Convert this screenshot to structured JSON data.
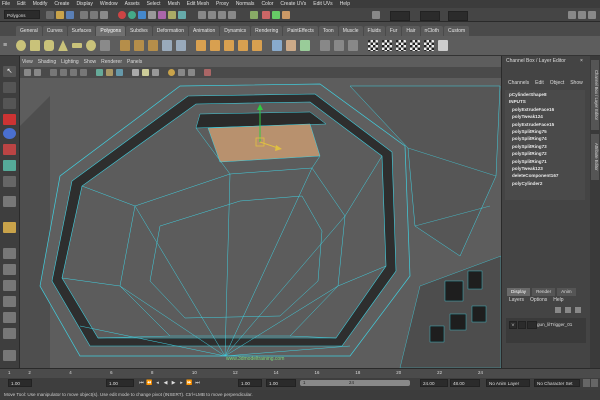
{
  "menubar": [
    "File",
    "Edit",
    "Modify",
    "Create",
    "Display",
    "Window",
    "Assets",
    "Select",
    "Mesh",
    "Edit Mesh",
    "Proxy",
    "Normals",
    "Color",
    "Create UVs",
    "Edit UVs",
    "Help"
  ],
  "status": {
    "mode": "Polygons"
  },
  "shelf_tabs": [
    {
      "label": "General"
    },
    {
      "label": "Curves"
    },
    {
      "label": "Surfaces"
    },
    {
      "label": "Polygons",
      "active": true
    },
    {
      "label": "Subdivs"
    },
    {
      "label": "Deformation"
    },
    {
      "label": "Animation"
    },
    {
      "label": "Dynamics"
    },
    {
      "label": "Rendering"
    },
    {
      "label": "PaintEffects"
    },
    {
      "label": "Toon"
    },
    {
      "label": "Muscle"
    },
    {
      "label": "Fluids"
    },
    {
      "label": "Fur"
    },
    {
      "label": "Hair"
    },
    {
      "label": "nCloth"
    },
    {
      "label": "Custom"
    }
  ],
  "viewport": {
    "menu": [
      "View",
      "Shading",
      "Lighting",
      "Show",
      "Renderer",
      "Panels"
    ],
    "watermark": "www.3dmodeltraining.com"
  },
  "channel_box": {
    "title": "Channel Box / Layer Editor",
    "menu": [
      "Channels",
      "Edit",
      "Object",
      "Show"
    ],
    "items": [
      "pCylinderShape8",
      "INPUTS",
      "polyExtrudeFace16",
      "polyTweak124",
      "polyExtrudeFace15",
      "polySplitRing75",
      "polySplitRing74",
      "polySplitRing73",
      "polySplitRing72",
      "polySplitRing71",
      "polyTweak123",
      "deleteComponent167",
      "polyCylinder2"
    ]
  },
  "layer_editor": {
    "tabs": [
      {
        "label": "Display",
        "active": true
      },
      {
        "label": "Render"
      },
      {
        "label": "Anim"
      }
    ],
    "menu": [
      "Layers",
      "Options",
      "Help"
    ],
    "layer_name": "gun_lilTrigger_01"
  },
  "side_tabs": [
    "Channel Box / Layer Editor",
    "Attribute Editor"
  ],
  "time_slider": {
    "ticks": [
      "1",
      "2",
      "4",
      "6",
      "8",
      "10",
      "12",
      "14",
      "16",
      "18",
      "20",
      "22",
      "24"
    ]
  },
  "range_slider": {
    "current_frame": "1.00",
    "start": "1.00",
    "range_start": "1.00",
    "range_low": "1",
    "range_high": "24",
    "end": "24.00",
    "anim_end": "48.00",
    "anim_layer": "No Anim Layer",
    "character_set": "No Character Set"
  },
  "help_line": "Move Tool: Use manipulator to move object(s). Use edit mode to change pivot (INSERT). Ctrl+LMB to move perpendicular.",
  "colors": {
    "wire": "#40d0e0",
    "mesh": "#5e5e5e",
    "selected_face": "#b8916e",
    "accent": "#e0c040"
  }
}
